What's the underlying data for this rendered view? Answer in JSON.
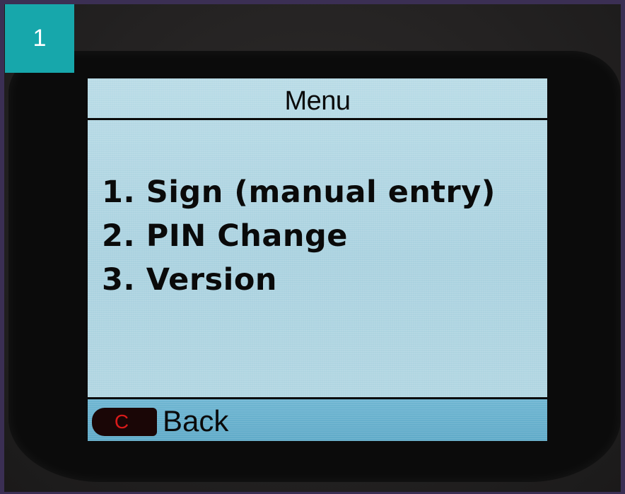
{
  "step_badge": {
    "label": "1",
    "color": "#17a7ab"
  },
  "screen": {
    "title": "Menu",
    "menu_items": [
      {
        "label": "1. Sign (manual entry)"
      },
      {
        "label": "2. PIN Change"
      },
      {
        "label": "3. Version"
      }
    ],
    "footer": {
      "back_key_glyph": "C",
      "back_key_color": "#d81a1a",
      "back_label": "Back"
    },
    "background_color": "#a9d1df"
  }
}
